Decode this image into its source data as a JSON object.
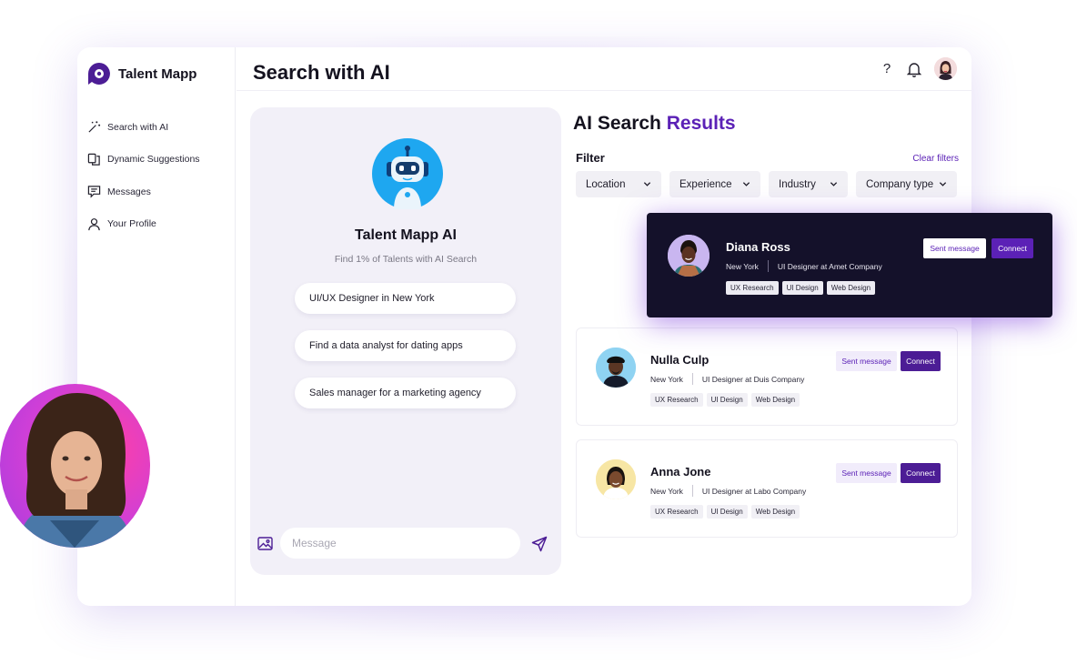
{
  "app": {
    "name": "Talent Mapp",
    "accent": "#5b21b6",
    "dark_card": "#14112a"
  },
  "sidebar": {
    "items": [
      {
        "label": "Search with AI",
        "icon": "magic-wand-icon"
      },
      {
        "label": "Dynamic Suggestions",
        "icon": "suggestions-icon"
      },
      {
        "label": "Messages",
        "icon": "message-icon"
      },
      {
        "label": "Your Profile",
        "icon": "user-icon"
      }
    ]
  },
  "header": {
    "title": "Search with AI",
    "help_icon": "question-mark-icon",
    "bell_icon": "bell-icon"
  },
  "chat": {
    "bot_name": "Talent Mapp AI",
    "subtitle": "Find 1% of Talents with AI Search",
    "suggestions": [
      "UI/UX Designer in New York",
      "Find a data analyst for dating apps",
      "Sales manager for a marketing agency"
    ],
    "input_placeholder": "Message"
  },
  "results": {
    "title_main": "AI Search ",
    "title_accent": "Results",
    "filter_label": "Filter",
    "clear_filters": "Clear filters",
    "filters": [
      "Location",
      "Experience",
      "Industry",
      "Company type"
    ],
    "sent_label": "Sent message",
    "connect_label": "Connect",
    "candidates": [
      {
        "name": "Diana Ross",
        "location": "New York",
        "role": "UI Designer at Amet Company",
        "tags": [
          "UX Research",
          "UI Design",
          "Web Design"
        ]
      },
      {
        "name": "Nulla Culp",
        "location": "New York",
        "role": "UI Designer at Duis Company",
        "tags": [
          "UX Research",
          "UI Design",
          "Web Design"
        ]
      },
      {
        "name": "Anna Jone",
        "location": "New York",
        "role": "UI Designer at Labo Company",
        "tags": [
          "UX Research",
          "UI Design",
          "Web Design"
        ]
      }
    ]
  }
}
